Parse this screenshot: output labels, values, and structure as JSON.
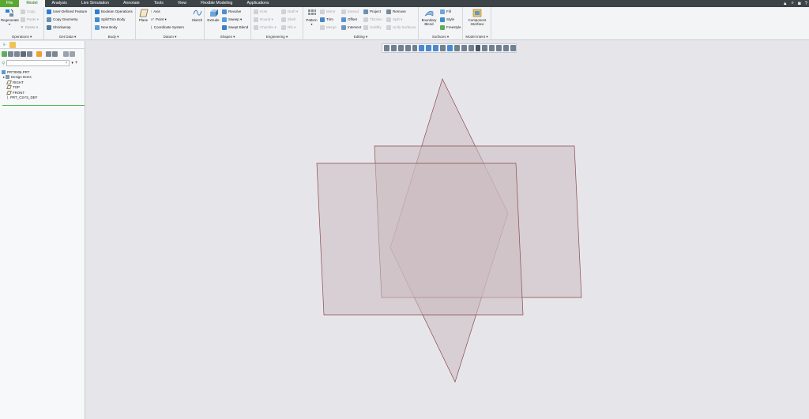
{
  "menubar": {
    "tabs": [
      "File",
      "Model",
      "Analysis",
      "Live Simulation",
      "Annotate",
      "Tools",
      "View",
      "Flexible Modeling",
      "Applications"
    ],
    "active_tab": "Model"
  },
  "ribbon": {
    "operations": {
      "label": "Operations ▾",
      "regenerate": "Regenerate",
      "copy": "Copy",
      "paste": "Paste ▾",
      "delete": "Delete ▾"
    },
    "get_data": {
      "label": "Get Data ▾",
      "user_defined_feature": "User-Defined Feature",
      "copy_geometry": "Copy Geometry",
      "shrinkwrap": "Shrinkwrap"
    },
    "body": {
      "label": "Body ▾",
      "boolean_operations": "Boolean Operations",
      "split_trim_body": "Split/Trim Body",
      "new_body": "New Body"
    },
    "datum": {
      "label": "Datum ▾",
      "plane": "Plane",
      "axis": "Axis",
      "point": "Point ▾",
      "coordinate_system": "Coordinate System",
      "sketch": "Sketch"
    },
    "shapes": {
      "label": "Shapes ▾",
      "extrude": "Extrude",
      "revolve": "Revolve",
      "sweep": "Sweep ▾",
      "swept_blend": "Swept Blend"
    },
    "engineering": {
      "label": "Engineering ▾",
      "hole": "Hole",
      "round": "Round ▾",
      "chamfer": "Chamfer ▾",
      "draft": "Draft ▾",
      "shell": "Shell",
      "rib": "Rib ▾"
    },
    "editing": {
      "label": "Editing ▾",
      "pattern": "Pattern",
      "mirror": "Mirror",
      "trim": "Trim",
      "merge": "Merge",
      "extend": "Extend",
      "offset": "Offset",
      "intersect": "Intersect",
      "project": "Project",
      "thicken": "Thicken",
      "solidify": "Solidify",
      "remove": "Remove",
      "split": "Split ▾",
      "unify_surfaces": "Unify Surfaces"
    },
    "surfaces": {
      "label": "Surfaces ▾",
      "boundary_blend": "Boundary Blend",
      "fill": "Fill",
      "style": "Style",
      "freestyle": "Freestyle"
    },
    "model_intent": {
      "label": "Model Intent ▾",
      "component_interface": "Component Interface"
    }
  },
  "tree": {
    "items": [
      "PRT0006.PRT",
      "Design Items",
      "RIGHT",
      "TOP",
      "FRONT",
      "PRT_CSYS_DEF"
    ]
  },
  "colors": {
    "menubar_bg": "#3c4448",
    "file_tab": "#5aa832",
    "ribbon_bg": "#f3f4f6",
    "viewport_bg": "#e6e6ea",
    "plane_fill": "#c8b8bc",
    "plane_edge": "#8c4a4e",
    "accent_icon": "#2f7fd0"
  }
}
